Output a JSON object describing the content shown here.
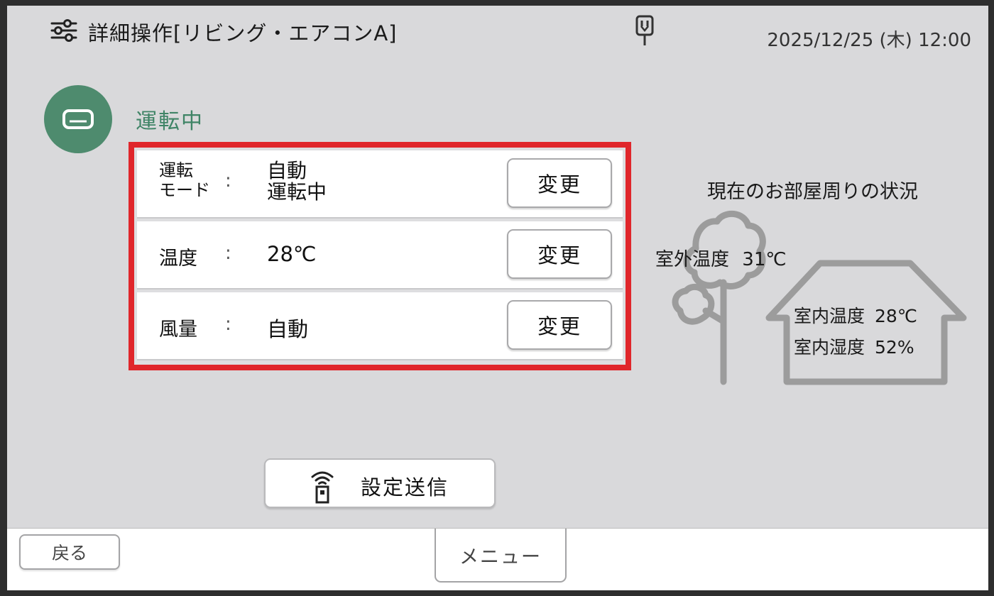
{
  "header": {
    "title": "詳細操作[リビング・エアコンA]",
    "datetime": "2025/12/25 (木) 12:00"
  },
  "status": {
    "label": "運転中",
    "color": "#4e8b6e"
  },
  "settings": {
    "highlight_color": "#e0262b",
    "rows": [
      {
        "label_line1": "運転",
        "label_line2": "モード",
        "colon": ":",
        "value_line1": "自動",
        "value_line2": "運転中",
        "button": "変更"
      },
      {
        "label": "温度",
        "colon": ":",
        "value": "28℃",
        "button": "変更"
      },
      {
        "label": "風量",
        "colon": ":",
        "value": "自動",
        "button": "変更"
      }
    ]
  },
  "room": {
    "title": "現在のお部屋周りの状況",
    "outdoor_label": "室外温度",
    "outdoor_value": "31℃",
    "indoor_temp_label": "室内温度",
    "indoor_temp_value": "28℃",
    "indoor_humidity_label": "室内湿度",
    "indoor_humidity_value": "52%"
  },
  "send_button": {
    "label": "設定送信"
  },
  "footer": {
    "back_label": "戻る",
    "menu_label": "メニュー"
  }
}
